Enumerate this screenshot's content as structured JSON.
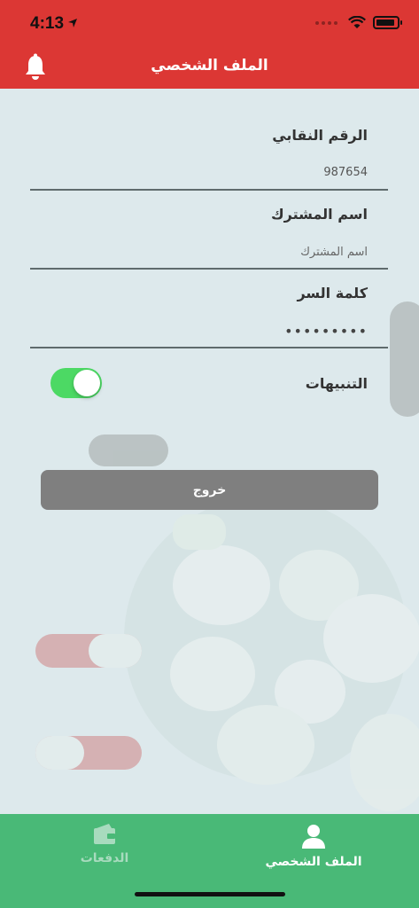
{
  "status": {
    "time": "4:13"
  },
  "header": {
    "title": "الملف الشخصي"
  },
  "form": {
    "union_number": {
      "label": "الرقم النقابي",
      "value": "987654"
    },
    "subscriber_name": {
      "label": "اسم المشترك",
      "placeholder": "اسم المشترك"
    },
    "password": {
      "label": "كلمة السر",
      "value": "•••••••••"
    },
    "notifications": {
      "label": "التنبيهات",
      "enabled": true
    }
  },
  "logout": {
    "label": "خروج"
  },
  "tabs": [
    {
      "label": "الملف الشخصي",
      "icon": "person-icon",
      "active": true
    },
    {
      "label": "الدفعات",
      "icon": "wallet-icon",
      "active": false
    }
  ],
  "colors": {
    "header": "#dc3734",
    "tabbar": "#49b977",
    "toggle_on": "#4cd964",
    "button": "#7f7f7f"
  }
}
